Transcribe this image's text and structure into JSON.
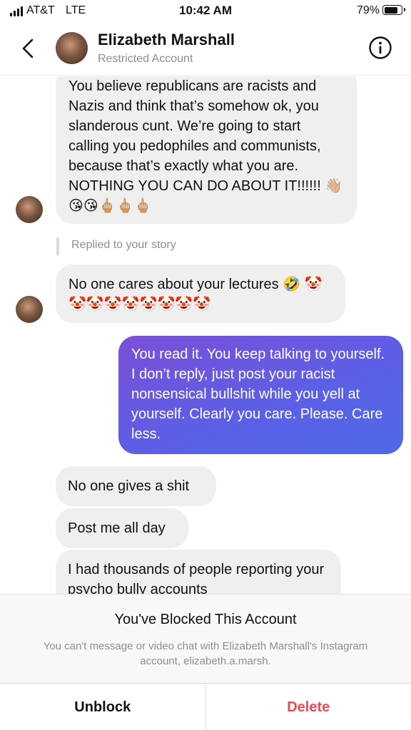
{
  "status_bar": {
    "carrier": "AT&T",
    "network": "LTE",
    "time": "10:42 AM",
    "battery_percent": "79%",
    "battery_level": 0.79
  },
  "header": {
    "name": "Elizabeth Marshall",
    "subtitle": "Restricted Account",
    "back_icon": "chevron-left-icon",
    "info_icon": "info-circle-icon"
  },
  "messages": [
    {
      "sender": "them",
      "text": "You believe republicans are racists and Nazis and think that’s somehow ok, you slanderous cunt. We’re going to start calling you pedophiles and communists, because that’s exactly what you are. NOTHING YOU CAN DO ABOUT IT!!!!!! 👋🏼😘😘🖕🏼🖕🏼🖕🏼"
    },
    {
      "sender": "note",
      "text": "Replied to your story"
    },
    {
      "sender": "them",
      "text": "No one cares about your lectures 🤣 🤡🤡🤡🤡🤡🤡🤡🤡🤡"
    },
    {
      "sender": "me",
      "text": "You read it. You keep talking to yourself. I don’t reply, just post your racist nonsensical bullshit while you yell at yourself. Clearly you care. Please. Care less."
    },
    {
      "sender": "them",
      "text": "No one gives a shit"
    },
    {
      "sender": "them",
      "text": "Post me all day"
    },
    {
      "sender": "them",
      "text": "I had thousands of people reporting your psycho bully accounts"
    }
  ],
  "blocked_panel": {
    "title": "You've Blocked This Account",
    "description": "You can't message or video chat with Elizabeth Marshall's Instagram account, elizabeth.a.marsh.",
    "unblock_label": "Unblock",
    "delete_label": "Delete",
    "delete_color": "#ed4956"
  },
  "colors": {
    "incoming_bubble": "#efefef",
    "outgoing_gradient_start": "#7b4fd8",
    "outgoing_gradient_end": "#4e6ae8",
    "muted_text": "#8e8e8e"
  }
}
